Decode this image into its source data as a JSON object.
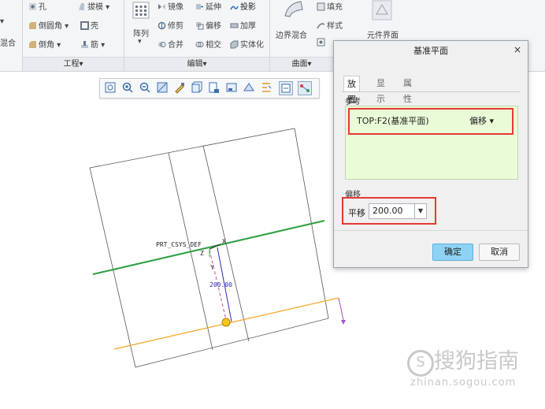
{
  "ribbon": {
    "items": {
      "hole": "孔",
      "draft": "拔模",
      "round": "倒圆角",
      "shell": "壳",
      "chamfer": "倒角",
      "rib": "筋",
      "pattern": "阵列",
      "mirror": "镜像",
      "extend": "延伸",
      "project": "投影",
      "trim": "修剪",
      "offset": "偏移",
      "thicken": "加厚",
      "merge": "合并",
      "intersect": "相交",
      "solidify": "实体化",
      "boundary_blend": "边界混合",
      "fill": "填充",
      "style": "样式",
      "component_interface": "元件界面",
      "left_cut_1": "▾",
      "left_cut_2": "混合"
    },
    "groups": {
      "engineering": "工程▾",
      "editing": "编辑▾",
      "surfaces": "曲面▾"
    }
  },
  "dialog": {
    "title": "基准平面",
    "close": "×",
    "tabs": [
      "放置",
      "显示",
      "属性"
    ],
    "references_label": "参考",
    "reference_item": "TOP:F2(基准平面)",
    "reference_constraint": "偏移 ▾",
    "offset_label": "偏移",
    "translation_label": "平移",
    "translation_value": "200.00",
    "ok": "确定",
    "cancel": "取消"
  },
  "viewport": {
    "csys_label": "PRT_CSYS_DEF",
    "axis_x": "X",
    "axis_z": "Z",
    "axis_y": "Y",
    "dimension": "200.00"
  },
  "watermark": {
    "brand": "搜狗指南",
    "url": "zhinan.sogou.com"
  },
  "colors": {
    "accent_button": "#8fd3f4",
    "green_plane": "#2ea043",
    "orange_plane": "#f5a623",
    "highlight_red": "#e53935",
    "reference_bg": "#eafbd7"
  }
}
